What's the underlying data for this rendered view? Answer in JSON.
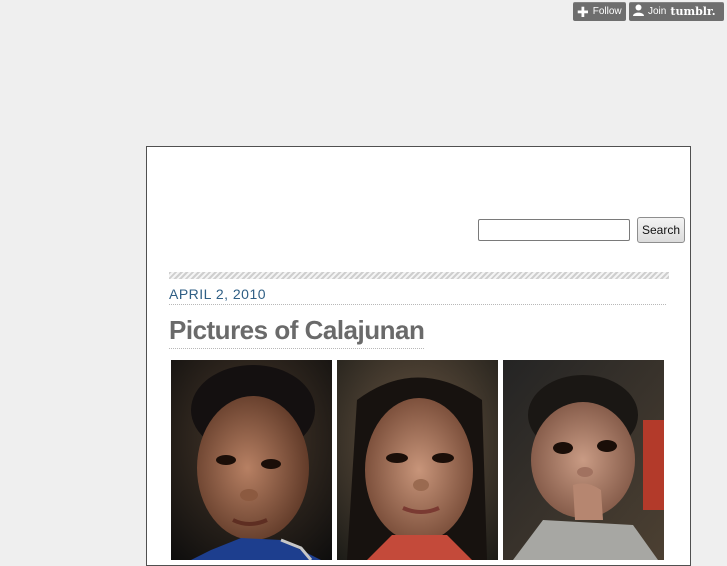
{
  "tumblr_controls": {
    "follow_label": "Follow",
    "join_label": "Join",
    "brand_label": "tumblr."
  },
  "search": {
    "button_label": "Search",
    "value": "",
    "placeholder": ""
  },
  "post": {
    "date": "APRIL 2, 2010",
    "title": "Pictures of Calajunan"
  },
  "colors": {
    "page_bg": "#efefef",
    "date_color": "#2f5f85",
    "title_color": "#6a6a6a",
    "button_dark": "#6e6e6e"
  },
  "icons": [
    "plus-icon",
    "user-icon"
  ]
}
